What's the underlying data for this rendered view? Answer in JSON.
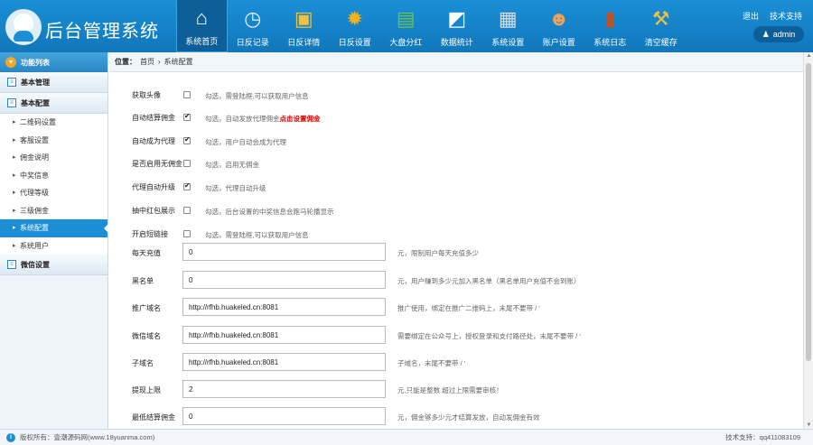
{
  "header": {
    "brand": "后台管理系统",
    "nav": [
      {
        "label": "系统首页",
        "icon": "home-icon",
        "glyph": "⌂",
        "color": "#ffffff",
        "active": true
      },
      {
        "label": "日反记录",
        "icon": "clock-icon",
        "glyph": "◷",
        "color": "#e9eef2",
        "active": false
      },
      {
        "label": "日反详情",
        "icon": "document-icon",
        "glyph": "▣",
        "color": "#f3c13a",
        "active": false
      },
      {
        "label": "日反设置",
        "icon": "gear-icon",
        "glyph": "✹",
        "color": "#f6b21b",
        "active": false
      },
      {
        "label": "大盘分红",
        "icon": "money-icon",
        "glyph": "▤",
        "color": "#6cc24a",
        "active": false
      },
      {
        "label": "数据统计",
        "icon": "chart-icon",
        "glyph": "◩",
        "color": "#ffffff",
        "active": false
      },
      {
        "label": "系统设置",
        "icon": "settings-icon",
        "glyph": "▦",
        "color": "#d8dde2",
        "active": false
      },
      {
        "label": "账户设置",
        "icon": "user-icon",
        "glyph": "☻",
        "color": "#f2a15a",
        "active": false
      },
      {
        "label": "系统日志",
        "icon": "book-icon",
        "glyph": "▮",
        "color": "#b8542c",
        "active": false
      },
      {
        "label": "清空缓存",
        "icon": "tools-icon",
        "glyph": "⚒",
        "color": "#f3c13a",
        "active": false
      }
    ],
    "logout": "退出",
    "support": "技术支持",
    "admin": "admin"
  },
  "sidebar": {
    "title": "功能列表",
    "sections": [
      {
        "label": "基本管理",
        "items": []
      },
      {
        "label": "基本配置",
        "items": [
          {
            "label": "二维码设置",
            "active": false
          },
          {
            "label": "客服设置",
            "active": false
          },
          {
            "label": "佣金说明",
            "active": false
          },
          {
            "label": "中奖信息",
            "active": false
          },
          {
            "label": "代理等级",
            "active": false
          },
          {
            "label": "三级佣金",
            "active": false
          },
          {
            "label": "系统配置",
            "active": true
          },
          {
            "label": "系统用户",
            "active": false
          }
        ]
      },
      {
        "label": "微信设置",
        "items": []
      }
    ]
  },
  "breadcrumb": {
    "prefix": "位置：",
    "home": "首页",
    "sep": "›",
    "current": "系统配置"
  },
  "form": {
    "checks": [
      {
        "label": "获取头像",
        "checked": false,
        "hint": "勾选，需登陆框,可以获取用户信息",
        "link": ""
      },
      {
        "label": "自动结算佣金",
        "checked": true,
        "hint": "勾选，自动发放代理佣金",
        "link": "点击设置佣金"
      },
      {
        "label": "自动成为代理",
        "checked": true,
        "hint": "勾选，用户自动会成为代理",
        "link": ""
      },
      {
        "label": "是否启用无佣金",
        "checked": false,
        "hint": "勾选，启用无佣金",
        "link": ""
      },
      {
        "label": "代理自动升级",
        "checked": true,
        "hint": "勾选，代理自动升级",
        "link": ""
      },
      {
        "label": "抽中红包展示",
        "checked": false,
        "hint": "勾选，后台设置的中奖信息会跑马轮播显示",
        "link": ""
      },
      {
        "label": "开启短链接",
        "checked": false,
        "hint": "勾选，需登陆框,可以获取用户信息",
        "link": ""
      }
    ],
    "inputs": [
      {
        "label": "每天充值",
        "value": "0",
        "hint": "元，限制用户每天充值多少"
      },
      {
        "label": "黑名单",
        "value": "0",
        "hint": "元，用户赚到多少元加入黑名单（黑名单用户充值不会到账）"
      },
      {
        "label": "推广域名",
        "value": "http://rfhb.huakeled.cn:8081",
        "hint": "推广使用，绑定在推广二维码上，末尾不要带  /  '"
      },
      {
        "label": "微信域名",
        "value": "http://rfhb.huakeled.cn:8081",
        "hint": "需要绑定在公众号上，授权登录和支付路径处，末尾不要带   /  '"
      },
      {
        "label": "子域名",
        "value": "http://rfhb.huakeled.cn:8081",
        "hint": "子域名，末尾不要带   /  '"
      },
      {
        "label": "提现上限",
        "value": "2",
        "hint": "元,只能是整数 超过上限需要审核！"
      },
      {
        "label": "最低结算佣金",
        "value": "0",
        "hint": "元，佣金够多少元才结算发放，自动发佣金有效"
      }
    ]
  },
  "footer": {
    "copyright": "版权所有：壹潮源码网(www.18yuanma.com)",
    "contact": "技术支持：qq411083109"
  }
}
